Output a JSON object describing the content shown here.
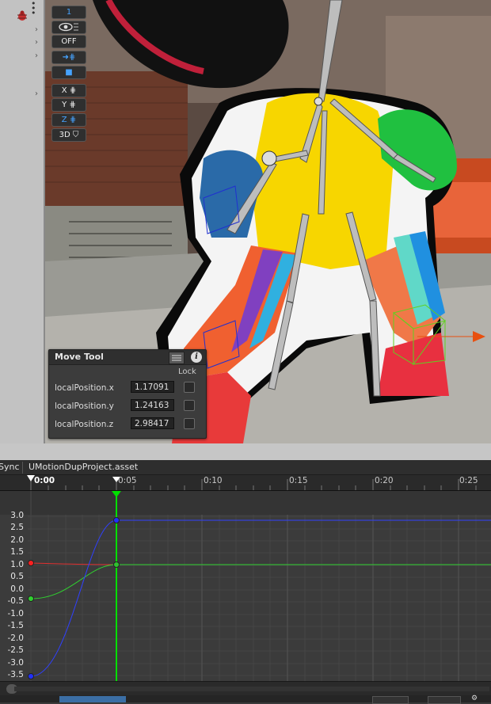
{
  "toolbar": {
    "counter_value": "1",
    "off_label": "OFF",
    "axis_x": "X",
    "axis_y": "Y",
    "axis_z": "Z",
    "mode_3d": "3D"
  },
  "move_tool": {
    "title": "Move Tool",
    "lock_header": "Lock",
    "rows": [
      {
        "label": "localPosition.x",
        "value": "1.17091"
      },
      {
        "label": "localPosition.y",
        "value": "1.24163"
      },
      {
        "label": "localPosition.z",
        "value": "2.98417"
      }
    ]
  },
  "tabs": {
    "left_tab": "Sync",
    "asset_name": "UMotionDupProject.asset"
  },
  "timeline": {
    "ticks": [
      "0:00",
      "0:05",
      "0:10",
      "0:15",
      "0:20",
      "0:25"
    ]
  },
  "curve_editor": {
    "y_labels": [
      "3.0",
      "2.5",
      "2.0",
      "1.5",
      "1.0",
      "0.5",
      "0.0",
      "-0.5",
      "-1.0",
      "-1.5",
      "-2.0",
      "-2.5",
      "-3.0",
      "-3.5"
    ]
  },
  "colors": {
    "accent_blue": "#46a3ff",
    "playhead_green": "#00e000",
    "curve_x": "#e03030",
    "curve_y": "#30d030",
    "curve_z": "#3040ff"
  }
}
